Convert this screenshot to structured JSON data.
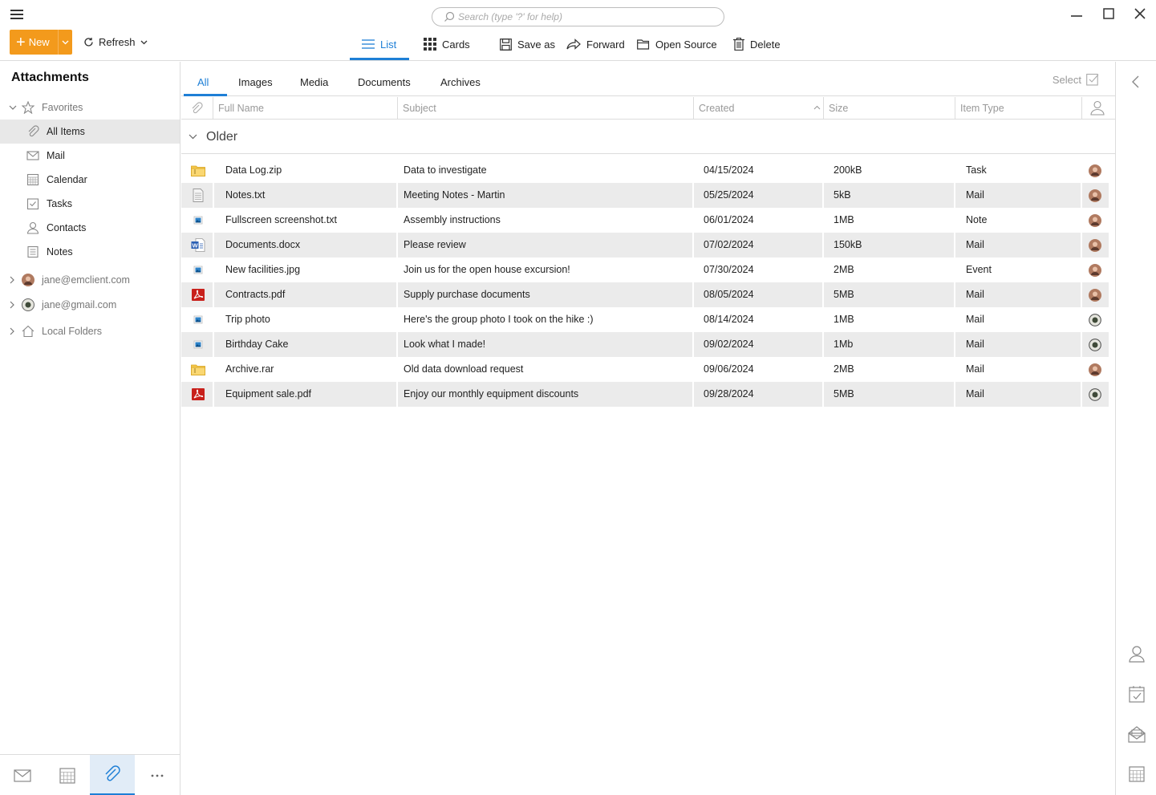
{
  "search": {
    "placeholder": "Search (type '?' for help)"
  },
  "toolbar": {
    "new_label": "New",
    "refresh_label": "Refresh",
    "list_label": "List",
    "cards_label": "Cards",
    "save_as_label": "Save as",
    "forward_label": "Forward",
    "open_source_label": "Open Source",
    "delete_label": "Delete"
  },
  "sidebar": {
    "title": "Attachments",
    "favorites_label": "Favorites",
    "items": [
      {
        "label": "All Items",
        "icon": "paperclip-icon"
      },
      {
        "label": "Mail",
        "icon": "mail-icon"
      },
      {
        "label": "Calendar",
        "icon": "calendar-icon"
      },
      {
        "label": "Tasks",
        "icon": "tasks-icon"
      },
      {
        "label": "Contacts",
        "icon": "contact-icon"
      },
      {
        "label": "Notes",
        "icon": "notes-icon"
      }
    ],
    "accounts": [
      {
        "label": "jane@emclient.com"
      },
      {
        "label": "jane@gmail.com"
      },
      {
        "label": "Local Folders"
      }
    ]
  },
  "tabs": [
    "All",
    "Images",
    "Media",
    "Documents",
    "Archives"
  ],
  "select_label": "Select",
  "columns": {
    "full_name": "Full Name",
    "subject": "Subject",
    "created": "Created",
    "size": "Size",
    "item_type": "Item Type"
  },
  "group_label": "Older",
  "rows": [
    {
      "name": "Data Log.zip",
      "subject": "Data to investigate",
      "created": "04/15/2024",
      "size": "200kB",
      "type": "Task",
      "icon": "archive-icon",
      "account": "emclient"
    },
    {
      "name": "Notes.txt",
      "subject": "Meeting Notes - Martin",
      "created": "05/25/2024",
      "size": "5kB",
      "type": "Mail",
      "icon": "text-file-icon",
      "account": "emclient"
    },
    {
      "name": "Fullscreen screenshot.txt",
      "subject": "Assembly instructions",
      "created": "06/01/2024",
      "size": "1MB",
      "type": "Note",
      "icon": "image-icon",
      "account": "emclient"
    },
    {
      "name": "Documents.docx",
      "subject": "Please review",
      "created": "07/02/2024",
      "size": "150kB",
      "type": "Mail",
      "icon": "word-icon",
      "account": "emclient"
    },
    {
      "name": "New facilities.jpg",
      "subject": "Join us for the open house excursion!",
      "created": "07/30/2024",
      "size": "2MB",
      "type": "Event",
      "icon": "image-icon",
      "account": "emclient"
    },
    {
      "name": "Contracts.pdf",
      "subject": "Supply purchase documents",
      "created": "08/05/2024",
      "size": "5MB",
      "type": "Mail",
      "icon": "pdf-icon",
      "account": "emclient"
    },
    {
      "name": "Trip photo",
      "subject": "Here's the group photo I took on the hike :)",
      "created": "08/14/2024",
      "size": "1MB",
      "type": "Mail",
      "icon": "image-icon",
      "account": "gmail"
    },
    {
      "name": "Birthday Cake",
      "subject": "Look what I made!",
      "created": "09/02/2024",
      "size": "1Mb",
      "type": "Mail",
      "icon": "image-icon",
      "account": "gmail"
    },
    {
      "name": "Archive.rar",
      "subject": "Old data download request",
      "created": "09/06/2024",
      "size": "2MB",
      "type": "Mail",
      "icon": "archive-icon",
      "account": "emclient"
    },
    {
      "name": "Equipment sale.pdf",
      "subject": "Enjoy our monthly equipment discounts",
      "created": "09/28/2024",
      "size": "5MB",
      "type": "Mail",
      "icon": "pdf-icon",
      "account": "gmail"
    }
  ],
  "colors": {
    "accent": "#1e7fd6",
    "new_button": "#f39a1c"
  }
}
